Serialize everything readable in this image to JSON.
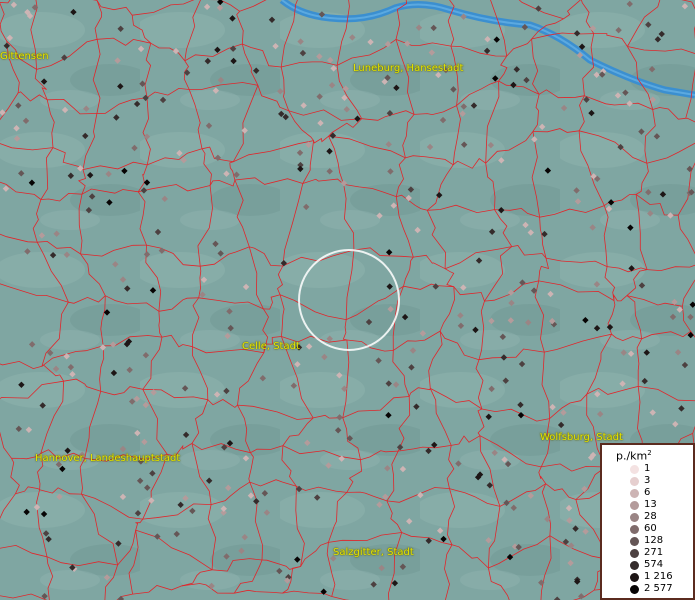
{
  "map": {
    "cities": [
      {
        "name": "Uelzen / Gittensen",
        "label": "Gittensen"
      },
      {
        "name": "Lueneburg",
        "label": "Luneburg, Hansestadt"
      },
      {
        "name": "Celle",
        "label": "Celle, Stadt"
      },
      {
        "name": "Hannover",
        "label": "Hannover, Landeshauptstadt"
      },
      {
        "name": "Wolfsburg",
        "label": "Wolfsburg, Stadt"
      },
      {
        "name": "Salzgitter",
        "label": "Salzgitter, Stadt"
      }
    ],
    "colors": {
      "background": "#7fa6a2",
      "boundary": "#e0262b",
      "river": "#3b8fd0",
      "label": "#e6e600",
      "selection_ring": "#ffffff"
    }
  },
  "legend": {
    "unit_label": "p./km",
    "unit_sup": "2",
    "entries": [
      {
        "label": "1",
        "color": "#f4e2e2"
      },
      {
        "label": "3",
        "color": "#e6cfcf"
      },
      {
        "label": "6",
        "color": "#cdb4b4"
      },
      {
        "label": "13",
        "color": "#b49b9b"
      },
      {
        "label": "28",
        "color": "#9a8585"
      },
      {
        "label": "60",
        "color": "#806c6c"
      },
      {
        "label": "128",
        "color": "#655656"
      },
      {
        "label": "271",
        "color": "#4d4141"
      },
      {
        "label": "574",
        "color": "#342b2b"
      },
      {
        "label": "1 216",
        "color": "#1d1616"
      },
      {
        "label": "2 577",
        "color": "#070404"
      }
    ]
  }
}
